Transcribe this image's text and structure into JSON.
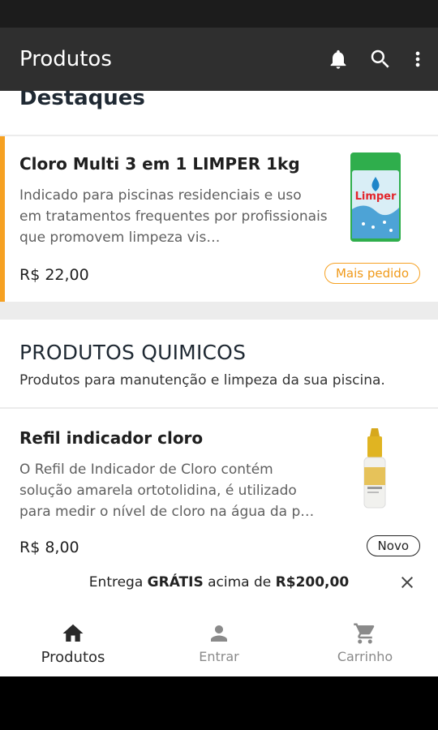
{
  "app_bar": {
    "title": "Produtos",
    "icons": [
      "bell-icon",
      "search-icon",
      "more-vert-icon"
    ]
  },
  "featured": {
    "section_title": "Destaques",
    "product": {
      "name": "Cloro Multi 3 em 1 LIMPER 1kg",
      "description": "Indicado para piscinas residenciais e uso em tratamentos frequentes por profissionais que promovem limpeza vis…",
      "price": "R$ 22,00",
      "badge": "Mais pedido",
      "image_logo": "Limper"
    }
  },
  "category": {
    "title": "PRODUTOS QUIMICOS",
    "subtitle": "Produtos para manutenção e limpeza da sua piscina.",
    "products": [
      {
        "name": "Refil indicador cloro",
        "description": "O Refil de Indicador de Cloro contém solução amarela ortotolidina, é utilizado para medir o nível de cloro na água da p…",
        "price": "R$ 8,00",
        "badge": "Novo"
      }
    ]
  },
  "free_shipping": {
    "prefix": "Entrega",
    "highlight": "GRÁTIS",
    "middle": "acima de",
    "amount": "R$200,00"
  },
  "bottom_nav": {
    "items": [
      {
        "label": "Produtos",
        "icon": "home-icon",
        "active": true
      },
      {
        "label": "Entrar",
        "icon": "person-icon",
        "active": false
      },
      {
        "label": "Carrinho",
        "icon": "cart-icon",
        "active": false
      }
    ]
  },
  "colors": {
    "app_bar": "#2f2f2f",
    "accent": "#f6a122",
    "background": "#ffffff"
  }
}
